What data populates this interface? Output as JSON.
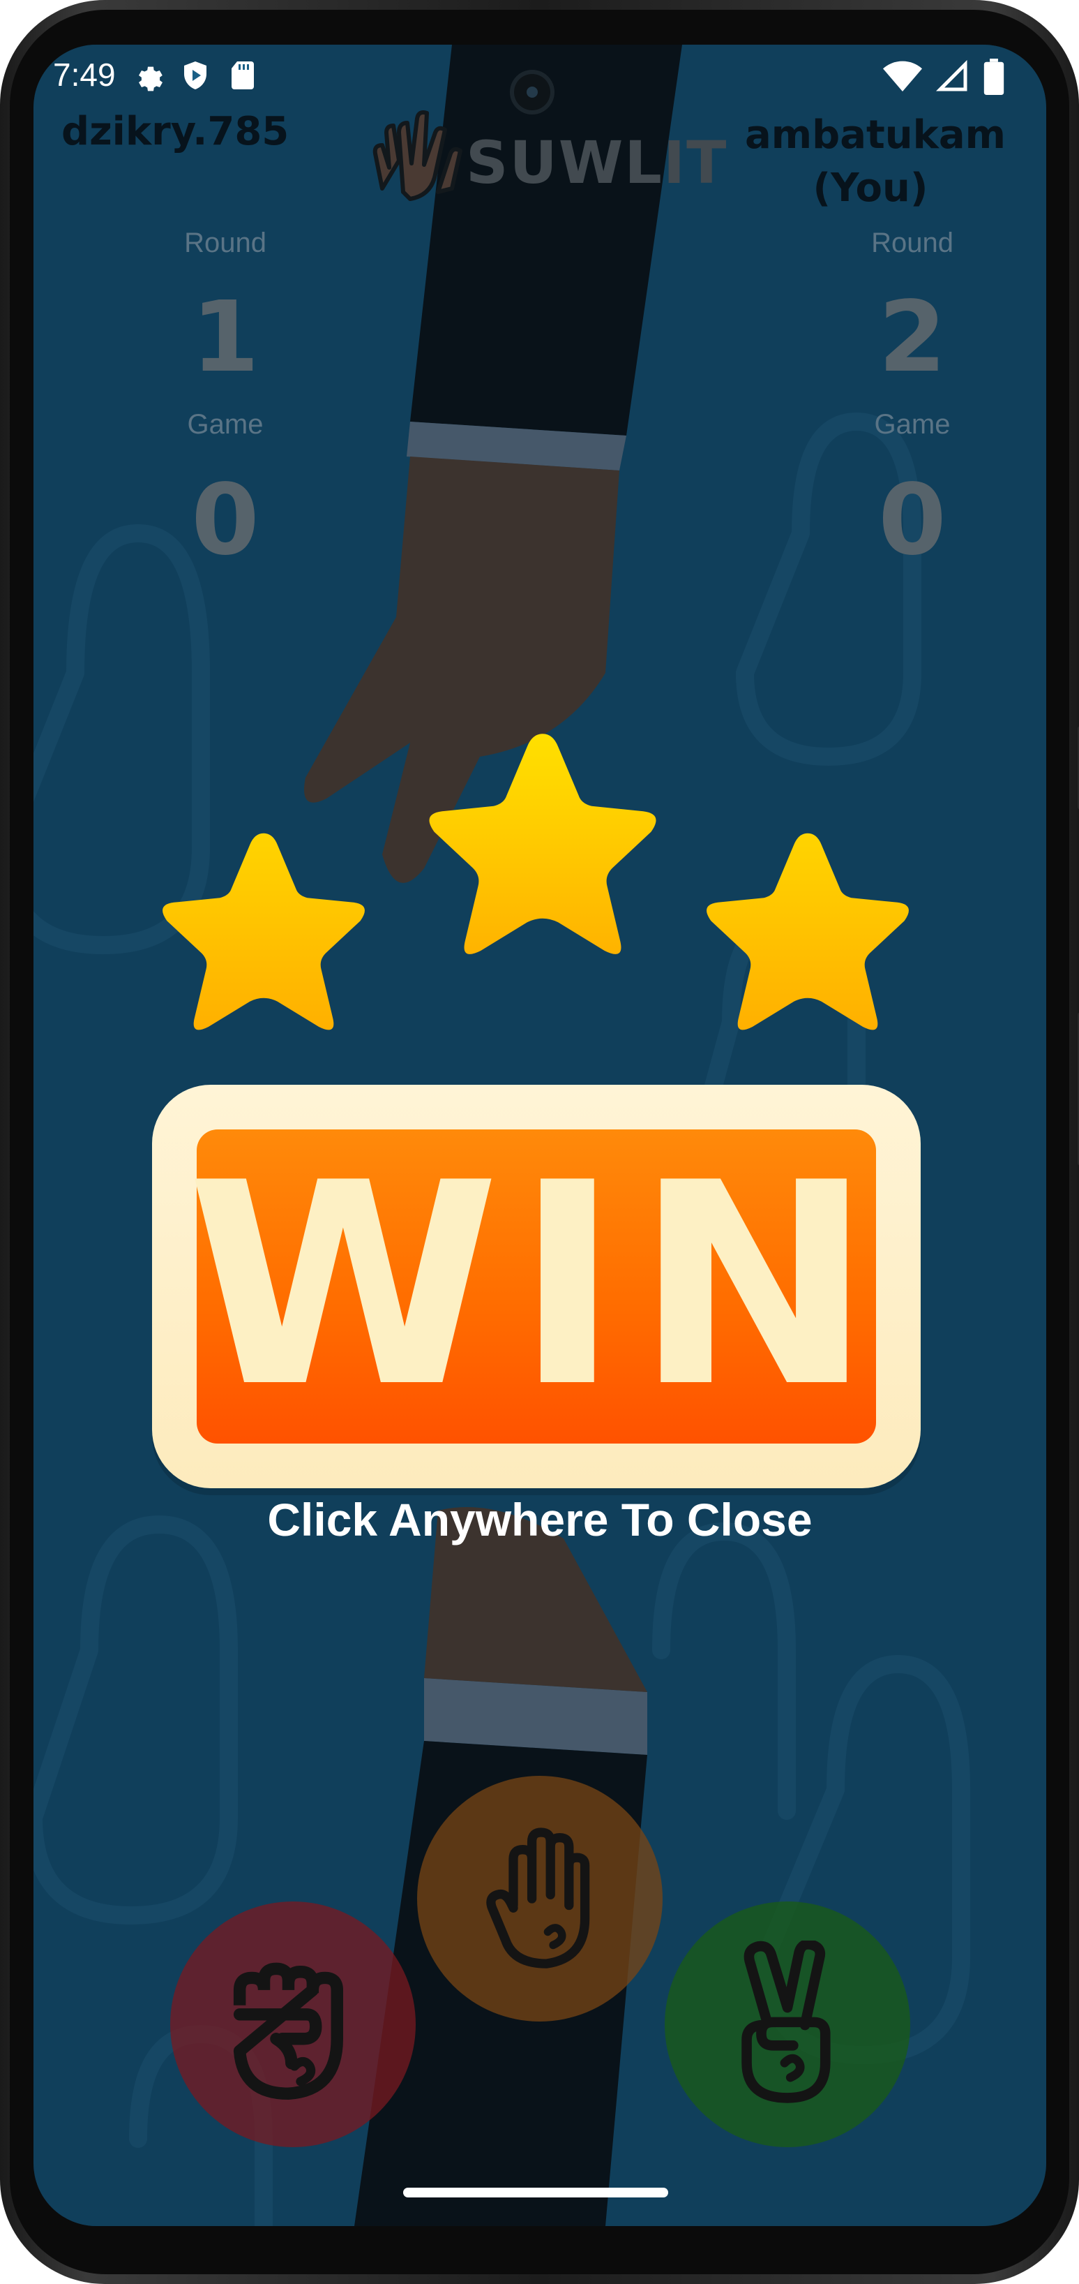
{
  "status_bar": {
    "time": "7:49",
    "left_icons": [
      "gear-icon",
      "shield-play-icon",
      "sd-card-icon"
    ],
    "right_icons": [
      "wifi-icon",
      "cellular-icon",
      "battery-icon"
    ]
  },
  "header": {
    "opponent_name": "dzikry.785",
    "player_name": "ambatukam",
    "player_tag": "(You)",
    "logo_text": "SUWLIT",
    "logo_icon": "hands-logo-icon"
  },
  "scores": {
    "round_label": "Round",
    "game_label": "Game",
    "opponent_round": "1",
    "opponent_game": "0",
    "player_round": "2",
    "player_game": "0"
  },
  "result_popup": {
    "stars": 3,
    "result_text": "WIN",
    "close_hint": "Click Anywhere To Close",
    "colors": {
      "star": "#ffc107",
      "frame": "#fff4d6",
      "banner": "#ff6d00",
      "text": "#fdf0c4"
    }
  },
  "choices": [
    {
      "name": "rock",
      "icon": "fist-icon",
      "color": "#7a1e24"
    },
    {
      "name": "paper",
      "icon": "open-hand-icon",
      "color": "#6d3e16"
    },
    {
      "name": "scissors",
      "icon": "peace-hand-icon",
      "color": "#1f5a1f"
    }
  ]
}
